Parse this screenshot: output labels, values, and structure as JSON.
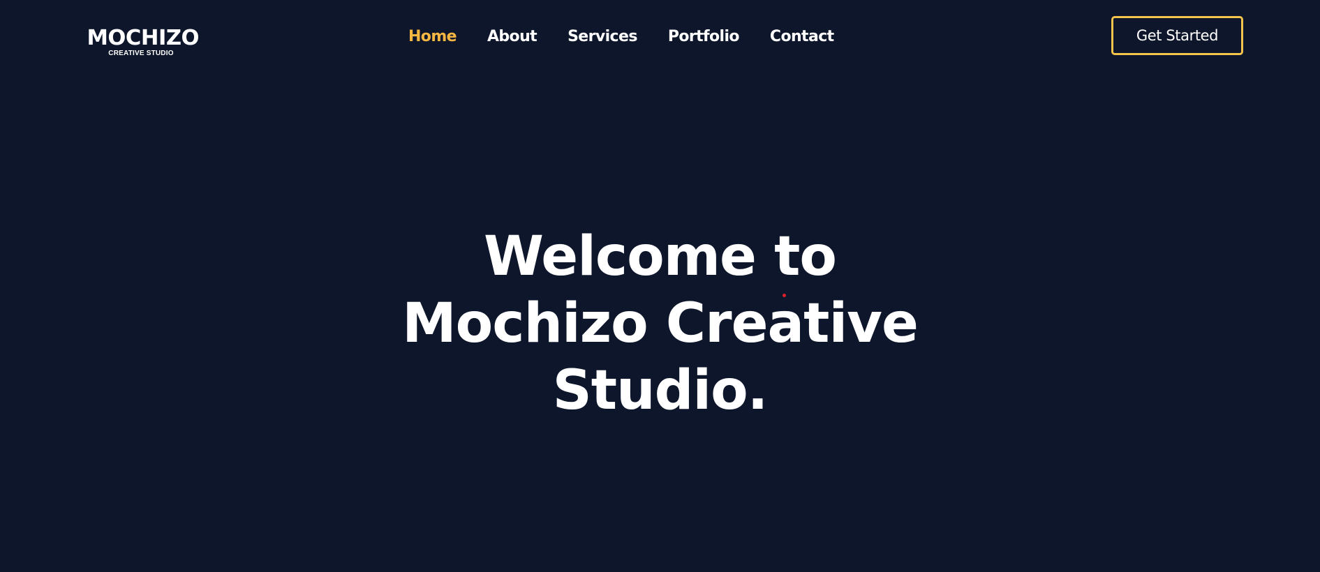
{
  "brand": {
    "name": "MOCHIZO",
    "tagline": "CREATIVE STUDIO"
  },
  "nav": {
    "items": [
      {
        "label": "Home",
        "active": true
      },
      {
        "label": "About",
        "active": false
      },
      {
        "label": "Services",
        "active": false
      },
      {
        "label": "Portfolio",
        "active": false
      },
      {
        "label": "Contact",
        "active": false
      }
    ]
  },
  "header": {
    "cta_label": "Get Started"
  },
  "hero": {
    "title_lines": [
      "Welcome to",
      "Mochizo Creative",
      "Studio."
    ]
  },
  "colors": {
    "background": "#0e162b",
    "accent": "#f5b642",
    "text": "#ffffff"
  }
}
